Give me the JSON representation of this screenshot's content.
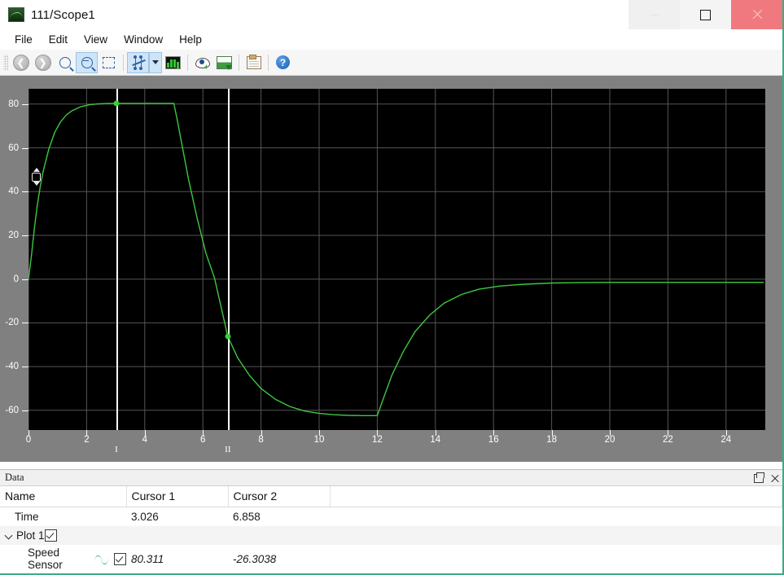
{
  "window": {
    "title": "111/Scope1",
    "app_icon": "scope-icon",
    "controls": {
      "minimize": "minimize-icon",
      "maximize": "maximize-icon",
      "close": "close-icon"
    }
  },
  "menubar": {
    "items": [
      "File",
      "Edit",
      "View",
      "Window",
      "Help"
    ]
  },
  "toolbar": {
    "buttons": [
      {
        "name": "back-icon",
        "label": "Back",
        "active": false
      },
      {
        "name": "forward-icon",
        "label": "Forward",
        "active": false
      },
      {
        "name": "zoom-in-icon",
        "label": "Zoom In",
        "active": false
      },
      {
        "name": "zoom-out-icon",
        "label": "Zoom Out",
        "active": true
      },
      {
        "name": "fit-to-view-icon",
        "label": "Fit to View",
        "active": false
      },
      {
        "name": "cursor-measurements-icon",
        "label": "Cursor Measurements",
        "active": true
      },
      {
        "name": "measurements-dropdown-icon",
        "label": "Measurements menu",
        "active": false
      },
      {
        "name": "configuration-properties-icon",
        "label": "Configuration Properties",
        "active": false
      },
      {
        "name": "highlight-signal-icon",
        "label": "Highlight Signal to Source",
        "active": false
      },
      {
        "name": "print-to-figure-icon",
        "label": "Print to Figure",
        "active": false
      },
      {
        "name": "copy-to-clipboard-icon",
        "label": "Copy to Clipboard",
        "active": false
      },
      {
        "name": "help-icon",
        "label": "Help",
        "active": false
      }
    ]
  },
  "plot": {
    "y_spinner": "y-range-spinner",
    "cursors": [
      {
        "label": "I",
        "time": 3.026,
        "value": 80.311
      },
      {
        "label": "II",
        "time": 6.858,
        "value": -26.3038
      }
    ]
  },
  "chart_data": {
    "type": "line",
    "title": "",
    "xlabel": "",
    "ylabel": "",
    "xlim": [
      0,
      25.35
    ],
    "ylim": [
      -69,
      87
    ],
    "grid": true,
    "legend": "none",
    "background": "#000000",
    "line_color": "#3ec73e",
    "xticks": [
      0,
      2,
      4,
      6,
      8,
      10,
      12,
      14,
      16,
      18,
      20,
      22,
      24
    ],
    "yticks": [
      80,
      60,
      40,
      20,
      0,
      -20,
      -40,
      -60
    ],
    "series": [
      {
        "name": "Speed Sensor",
        "x": [
          0,
          0.1,
          0.2,
          0.3,
          0.4,
          0.5,
          0.7,
          0.9,
          1.1,
          1.3,
          1.5,
          1.8,
          2.1,
          2.4,
          2.7,
          3.026,
          3.4,
          3.8,
          4.2,
          4.6,
          5.0,
          5.1,
          5.3,
          5.5,
          5.8,
          6.1,
          6.4,
          6.858,
          7.2,
          7.6,
          8.0,
          8.5,
          9.0,
          9.5,
          10.0,
          10.5,
          11.0,
          11.5,
          12.0,
          12.2,
          12.5,
          12.9,
          13.3,
          13.8,
          14.3,
          14.9,
          15.5,
          16.2,
          17.0,
          18.0,
          19.0,
          20.0,
          21.5,
          23.0,
          25.3
        ],
        "y": [
          0.0,
          10.5,
          23.0,
          33.5,
          42.0,
          49.0,
          59.5,
          67.0,
          71.8,
          75.0,
          77.0,
          78.8,
          79.7,
          80.1,
          80.25,
          80.311,
          80.33,
          80.33,
          80.33,
          80.33,
          80.33,
          74.0,
          60.0,
          46.0,
          28.0,
          12.0,
          0.5,
          -26.3038,
          -36.0,
          -44.0,
          -50.0,
          -55.0,
          -58.3,
          -60.3,
          -61.4,
          -62.0,
          -62.3,
          -62.4,
          -62.4,
          -55.0,
          -44.0,
          -33.0,
          -24.0,
          -16.5,
          -11.0,
          -7.0,
          -4.6,
          -3.2,
          -2.4,
          -1.8,
          -1.6,
          -1.5,
          -1.5,
          -1.5,
          -1.5
        ]
      }
    ]
  },
  "data_panel": {
    "title": "Data",
    "undock_icon": "undock-icon",
    "close_icon": "close-icon",
    "columns": [
      "Name",
      "Cursor 1",
      "Cursor 2"
    ],
    "rows": [
      {
        "name": "Time",
        "indent": 1,
        "has_chevron": false,
        "has_wave": false,
        "has_checkbox": false,
        "cursor1": "3.026",
        "cursor2": "6.858",
        "italic": false
      },
      {
        "name": "Plot 1",
        "indent": 1,
        "has_chevron": true,
        "has_wave": false,
        "has_checkbox": true,
        "cursor1": "",
        "cursor2": "",
        "italic": false
      },
      {
        "name": "Speed Sensor",
        "indent": 2,
        "has_chevron": false,
        "has_wave": true,
        "has_checkbox": true,
        "cursor1": "80.311",
        "cursor2": "-26.3038",
        "italic": true
      }
    ]
  },
  "colors": {
    "signal_green": "#3ec73e",
    "plot_background": "#000000",
    "grid": "#555555",
    "panel_background": "#808080",
    "toolbar_highlight": "#cfe4f7",
    "close_button": "#f0797f"
  }
}
